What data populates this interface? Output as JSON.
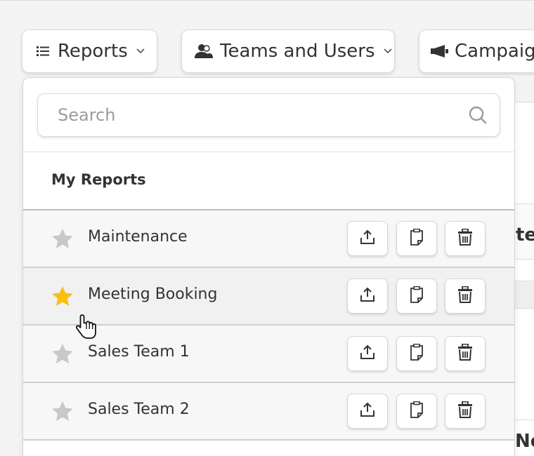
{
  "tabs": {
    "reports_label": "Reports",
    "teams_label": "Teams and Users",
    "campaigns_label": "Campaign"
  },
  "background": {
    "fragment_1": "te)",
    "fragment_2": "No"
  },
  "dropdown": {
    "search_placeholder": "Search",
    "search_value": "",
    "section_title": "My Reports",
    "reports": [
      {
        "name": "Maintenance",
        "starred": false
      },
      {
        "name": "Meeting Booking",
        "starred": true
      },
      {
        "name": "Sales Team 1",
        "starred": false
      },
      {
        "name": "Sales Team 2",
        "starred": false
      }
    ]
  },
  "colors": {
    "star_active": "#f9bf15",
    "star_inactive": "#c8c8c8",
    "text": "#333333"
  },
  "icons": {
    "reports_tab": "list-icon",
    "teams_tab": "user-group-icon",
    "campaigns_tab": "megaphone-icon",
    "search": "search-icon",
    "export": "export-icon",
    "copy": "copy-icon",
    "delete": "trash-icon",
    "favorite": "star-icon"
  }
}
